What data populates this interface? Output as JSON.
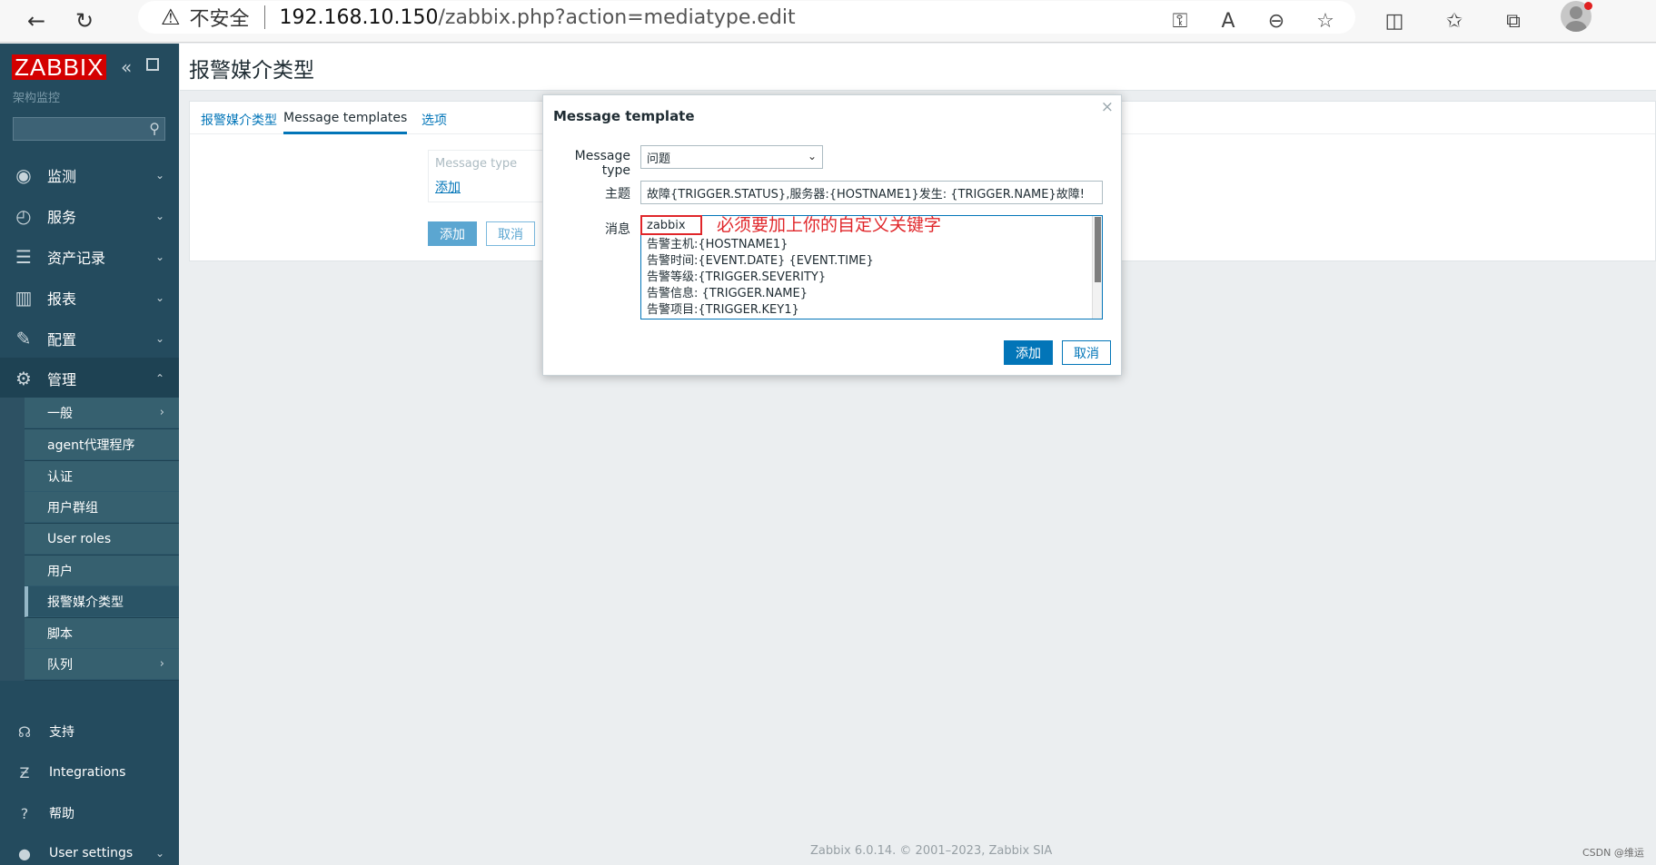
{
  "browser": {
    "insecure_label": "不安全",
    "url_host": "192.168.10.150",
    "url_path": "/zabbix.php?action=mediatype.edit"
  },
  "sidebar": {
    "logo": "ZABBIX",
    "subtitle": "架构监控",
    "menu": [
      {
        "label": "监测",
        "icon": "eye-icon"
      },
      {
        "label": "服务",
        "icon": "clock-icon"
      },
      {
        "label": "资产记录",
        "icon": "list-icon"
      },
      {
        "label": "报表",
        "icon": "bar-chart-icon"
      },
      {
        "label": "配置",
        "icon": "wrench-icon"
      },
      {
        "label": "管理",
        "icon": "gear-icon"
      }
    ],
    "admin_items": [
      "一般",
      "agent代理程序",
      "认证",
      "用户群组",
      "User roles",
      "用户",
      "报警媒介类型",
      "脚本",
      "队列"
    ],
    "bottom": [
      {
        "label": "支持",
        "icon": "headset-icon"
      },
      {
        "label": "Integrations",
        "icon": "integrations-icon"
      },
      {
        "label": "帮助",
        "icon": "help-icon"
      },
      {
        "label": "User settings",
        "icon": "user-icon"
      }
    ]
  },
  "page": {
    "title": "报警媒介类型",
    "tabs": [
      "报警媒介类型",
      "Message templates",
      "选项"
    ],
    "inner_label": "Message type",
    "inner_add": "添加",
    "add_button": "添加",
    "cancel_button": "取消"
  },
  "modal": {
    "title": "Message template",
    "close": "×",
    "message_type_label": "Message type",
    "message_type_value": "问题",
    "subject_label": "主题",
    "subject_value": "故障{TRIGGER.STATUS},服务器:{HOSTNAME1}发生: {TRIGGER.NAME}故障!",
    "message_label": "消息",
    "message_lines": [
      "zabbix",
      "告警主机:{HOSTNAME1}",
      "告警时间:{EVENT.DATE} {EVENT.TIME}",
      "告警等级:{TRIGGER.SEVERITY}",
      "告警信息: {TRIGGER.NAME}",
      "告警项目:{TRIGGER.KEY1}"
    ],
    "annotation": "必须要加上你的自定义关键字",
    "add_button": "添加",
    "cancel_button": "取消"
  },
  "footer": "Zabbix 6.0.14. © 2001–2023, Zabbix SIA",
  "watermark": "CSDN @维运",
  "colors": {
    "accent": "#0275b8",
    "sidebar": "#244b5e",
    "annotation": "#e0262a",
    "logo": "#d40000"
  }
}
